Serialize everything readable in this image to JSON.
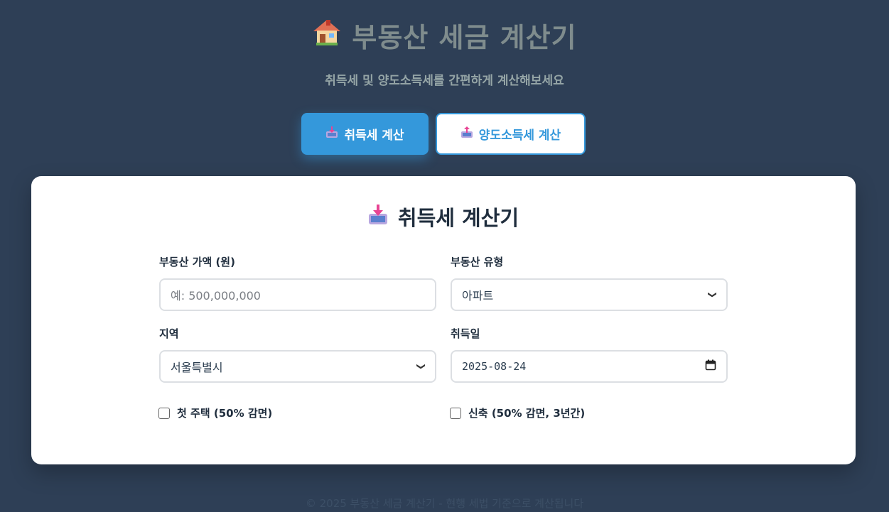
{
  "header": {
    "icon": "house-icon",
    "title": "부동산 세금 계산기",
    "subtitle": "취득세 및 양도소득세를 간편하게 계산해보세요"
  },
  "tabs": [
    {
      "label": "취득세 계산",
      "icon": "inbox-tray-icon",
      "active": true
    },
    {
      "label": "양도소득세 계산",
      "icon": "outbox-tray-icon",
      "active": false
    }
  ],
  "card": {
    "title": "취득세 계산기",
    "icon": "inbox-tray-icon",
    "fields": {
      "price": {
        "label": "부동산 가액 (원)",
        "placeholder": "예: 500,000,000",
        "value": ""
      },
      "type": {
        "label": "부동산 유형",
        "value": "아파트"
      },
      "region": {
        "label": "지역",
        "value": "서울특별시"
      },
      "date": {
        "label": "취득일",
        "value": "2025-08-24"
      }
    },
    "checkboxes": {
      "first_home": {
        "label": "첫 주택 (50% 감면)",
        "checked": false
      },
      "new_build": {
        "label": "신축 (50% 감면, 3년간)",
        "checked": false
      }
    }
  },
  "footer": {
    "text": "© 2025 부동산 세금 계산기 - 현행 세법 기준으로 계산됩니다"
  },
  "colors": {
    "background": "#2e3f56",
    "accent": "#3498db",
    "card": "#ffffff"
  }
}
